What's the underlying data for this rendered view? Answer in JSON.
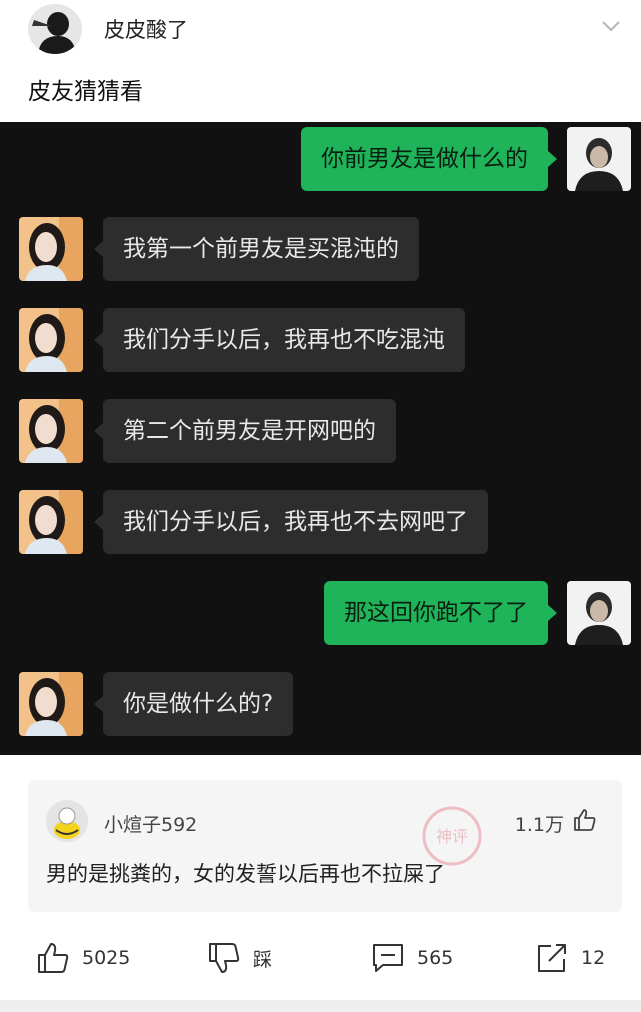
{
  "post": {
    "author_name": "皮皮酸了",
    "text": "皮友猜猜看"
  },
  "chat": {
    "messages": [
      {
        "side": "sent",
        "text": "你前男友是做什么的"
      },
      {
        "side": "recv",
        "text": "我第一个前男友是买混沌的"
      },
      {
        "side": "recv",
        "text": "我们分手以后，我再也不吃混沌"
      },
      {
        "side": "recv",
        "text": "第二个前男友是开网吧的"
      },
      {
        "side": "recv",
        "text": "我们分手以后，我再也不去网吧了"
      },
      {
        "side": "sent",
        "text": "那这回你跑不了了"
      },
      {
        "side": "recv",
        "text": "你是做什么的?"
      }
    ]
  },
  "comment": {
    "user_name": "小煊子592",
    "likes": "1.1万",
    "text": "男的是挑粪的，女的发誓以后再也不拉屎了",
    "stamp_text": "神评"
  },
  "actions": {
    "like_count": "5025",
    "dislike_label": "踩",
    "comment_count": "565",
    "share_count": "12"
  },
  "colors": {
    "chat_background": "#111111",
    "sent_bubble": "#1fb35a",
    "received_bubble": "#2d2d2d"
  }
}
